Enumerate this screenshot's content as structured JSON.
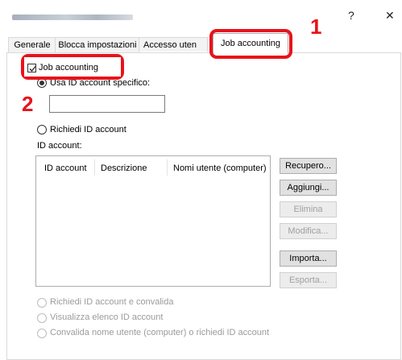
{
  "window": {
    "close_glyph": "✕",
    "help_glyph": "?"
  },
  "tabs": [
    {
      "label": "Generale"
    },
    {
      "label": "Blocca impostazioni"
    },
    {
      "label": "Accesso uten"
    },
    {
      "label": "Job accounting",
      "active": true
    }
  ],
  "callouts": {
    "first": "1",
    "second": "2",
    "color": "#e8131b"
  },
  "job_accounting_checkbox": {
    "label": "Job accounting",
    "checked": true
  },
  "options": {
    "specific_account": {
      "label": "Usa ID account specifico:",
      "checked": true
    },
    "specific_account_value": "",
    "prompt_account": {
      "label": "Richiedi ID account",
      "checked": false
    }
  },
  "account_list": {
    "label": "ID account:",
    "columns": [
      "ID account",
      "Descrizione",
      "Nomi utente (computer)"
    ],
    "rows": []
  },
  "buttons": {
    "retrieve": {
      "label": "Recupero...",
      "enabled": true
    },
    "add": {
      "label": "Aggiungi...",
      "enabled": true
    },
    "delete": {
      "label": "Elimina",
      "enabled": false
    },
    "edit": {
      "label": "Modifica...",
      "enabled": false
    },
    "import": {
      "label": "Importa...",
      "enabled": true
    },
    "export": {
      "label": "Esporta...",
      "enabled": false
    }
  },
  "bottom_options": [
    {
      "label": "Richiedi ID account e convalida",
      "enabled": false
    },
    {
      "label": "Visualizza elenco ID account",
      "enabled": false
    },
    {
      "label": "Convalida nome utente (computer) o richiedi ID account",
      "enabled": false
    }
  ]
}
